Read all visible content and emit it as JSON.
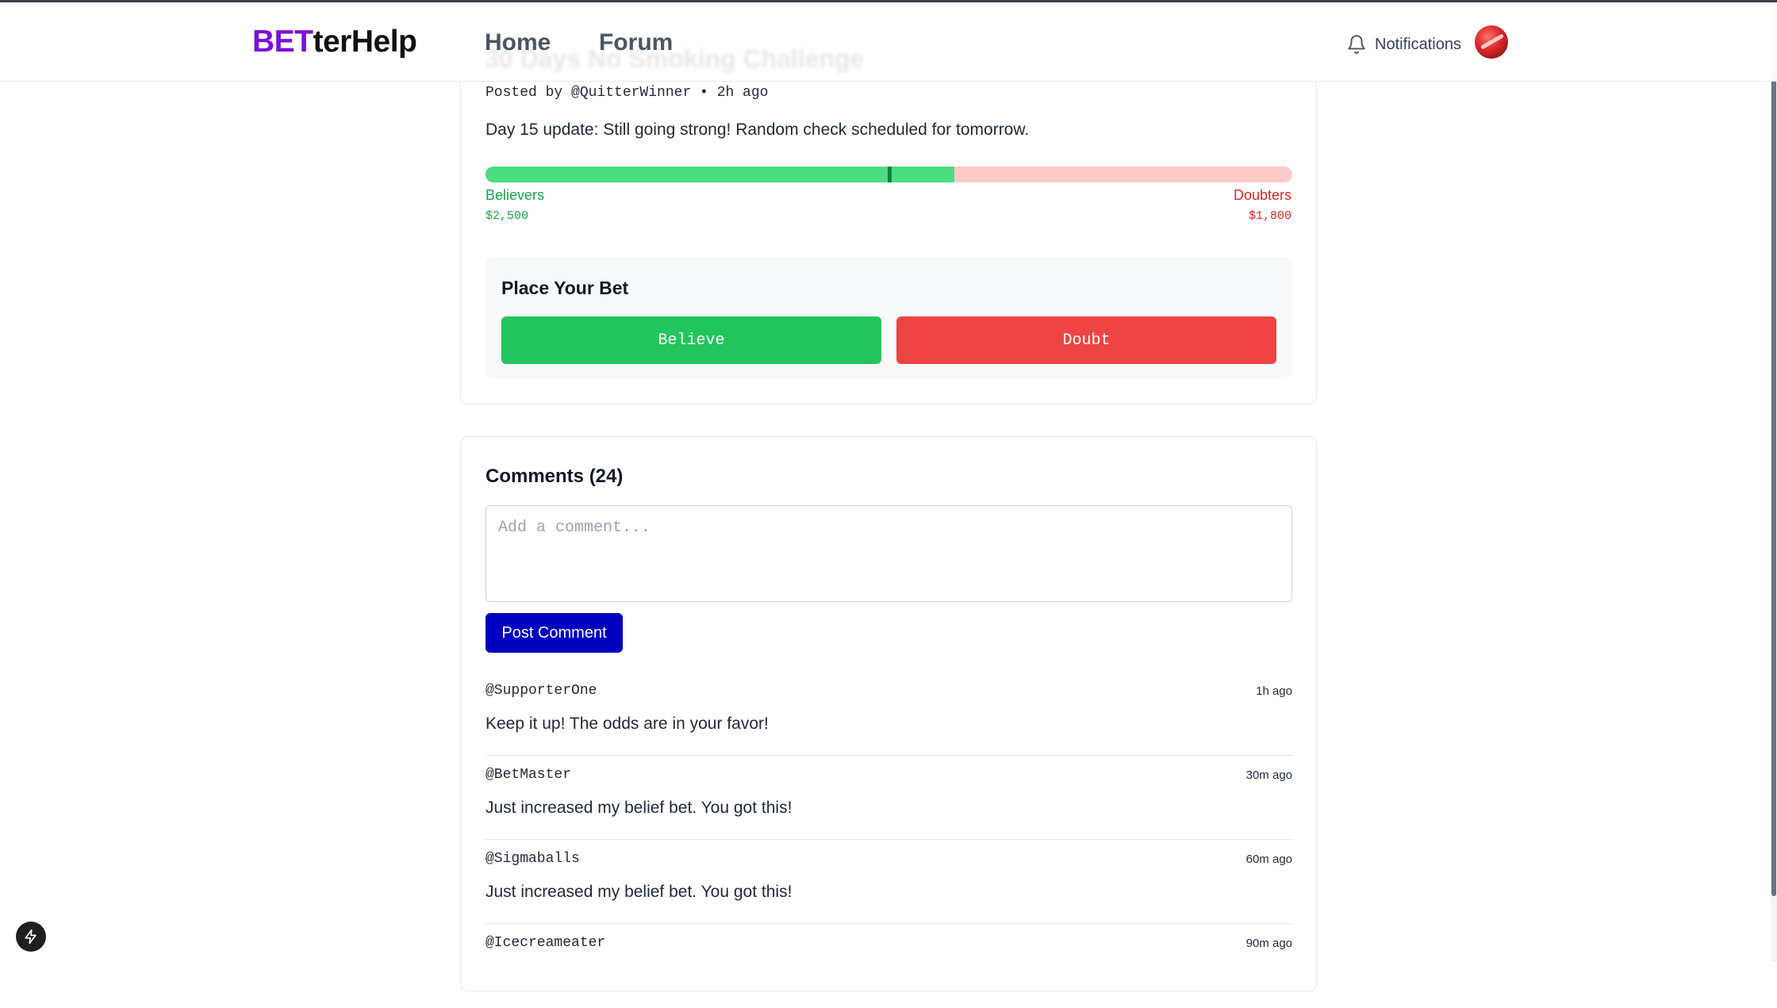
{
  "header": {
    "logo_accent": "BET",
    "logo_rest": "terHelp",
    "nav": {
      "home": "Home",
      "forum": "Forum"
    },
    "notifications_label": "Notifications"
  },
  "post": {
    "title": "30 Days No Smoking Challenge",
    "meta": "Posted by @QuitterWinner • 2h ago",
    "body": "Day 15 update: Still going strong! Random check scheduled for tomorrow.",
    "believers_label": "Believers",
    "doubters_label": "Doubters",
    "believers_amount": "$2,500",
    "doubters_amount": "$1,800",
    "believers_share": 0.5814,
    "marker_share": 0.5
  },
  "bet": {
    "title": "Place Your Bet",
    "believe_label": "Believe",
    "doubt_label": "Doubt"
  },
  "comments": {
    "title": "Comments (24)",
    "placeholder": "Add a comment...",
    "post_button": "Post Comment",
    "items": [
      {
        "user": "@SupporterOne",
        "time": "1h ago",
        "text": "Keep it up! The odds are in your favor!"
      },
      {
        "user": "@BetMaster",
        "time": "30m ago",
        "text": "Just increased my belief bet. You got this!"
      },
      {
        "user": "@Sigmaballs",
        "time": "60m ago",
        "text": "Just increased my belief bet. You got this!"
      },
      {
        "user": "@Icecreameater",
        "time": "90m ago",
        "text": ""
      }
    ]
  },
  "colors": {
    "brand_purple": "#7c0fd8",
    "believe_green": "#22c55e",
    "doubt_red": "#ef4444",
    "post_button_blue": "#0000c0"
  },
  "icons": {
    "notifications": "bell-icon",
    "fab": "bolt-icon"
  }
}
